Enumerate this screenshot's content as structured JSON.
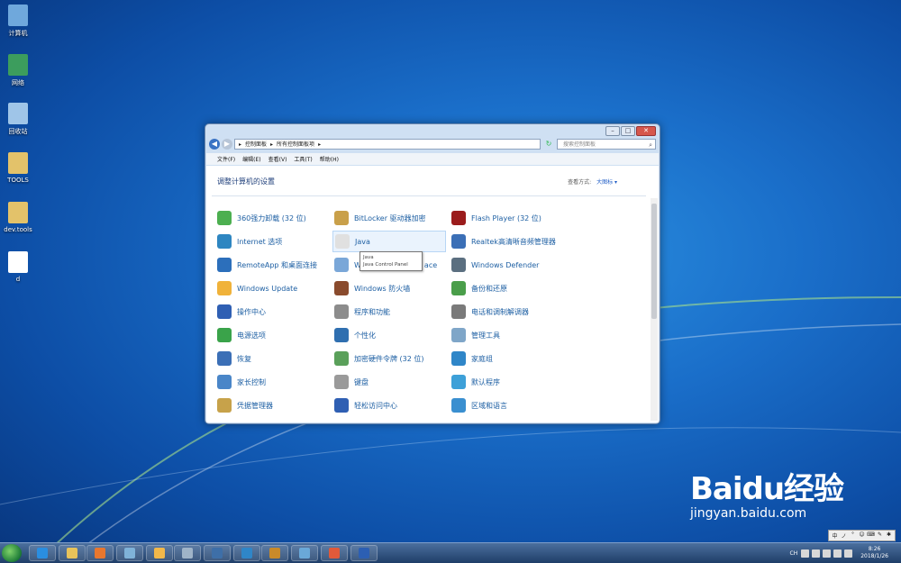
{
  "desktop": {
    "icons": [
      {
        "label": "计算机",
        "color": "#6fa8dc"
      },
      {
        "label": "网络",
        "color": "#3c9d5d"
      },
      {
        "label": "回收站",
        "color": "#9fc5e8"
      },
      {
        "label": "TOOLS",
        "color": "#e3c26a"
      },
      {
        "label": "dev.tools",
        "color": "#e3c26a"
      },
      {
        "label": "d",
        "color": "#ffffff"
      }
    ]
  },
  "window": {
    "breadcrumb": [
      "控制面板",
      "所有控制面板项"
    ],
    "search_placeholder": "搜索控制面板",
    "menu": [
      "文件(F)",
      "编辑(E)",
      "查看(V)",
      "工具(T)",
      "帮助(H)"
    ],
    "heading": "调整计算机的设置",
    "view_by_label": "查看方式:",
    "view_by_value": "大图标 ▾",
    "items": [
      {
        "label": "360强力卸载 (32 位)",
        "color": "#4caf50"
      },
      {
        "label": "BitLocker 驱动器加密",
        "color": "#c9a04a"
      },
      {
        "label": "Flash Player (32 位)",
        "color": "#9b1c1c"
      },
      {
        "label": "Internet 选项",
        "color": "#2e86c1"
      },
      {
        "label": "Java",
        "color": "#e0e0e0"
      },
      {
        "label": "Realtek高清晰音频管理器",
        "color": "#3b6fb6"
      },
      {
        "label": "RemoteApp 和桌面连接",
        "color": "#2c6fbb"
      },
      {
        "label": "W",
        "suffix": "ace",
        "color": "#7aa7d8"
      },
      {
        "label": "Windows Defender",
        "color": "#5b6f80"
      },
      {
        "label": "Windows Update",
        "color": "#f0b23a"
      },
      {
        "label": "Windows 防火墙",
        "color": "#8a4b2d"
      },
      {
        "label": "备份和还原",
        "color": "#4a9e4a"
      },
      {
        "label": "操作中心",
        "color": "#2f5fb3"
      },
      {
        "label": "程序和功能",
        "color": "#8c8c8c"
      },
      {
        "label": "电话和调制解调器",
        "color": "#7a7a7a"
      },
      {
        "label": "电源选项",
        "color": "#3aa34a"
      },
      {
        "label": "个性化",
        "color": "#2f6fb0"
      },
      {
        "label": "管理工具",
        "color": "#7fa6c8"
      },
      {
        "label": "恢复",
        "color": "#3b6fb6"
      },
      {
        "label": "加密硬件令牌 (32 位)",
        "color": "#5aa05a"
      },
      {
        "label": "家庭组",
        "color": "#2f86c8"
      },
      {
        "label": "家长控制",
        "color": "#4a86c8"
      },
      {
        "label": "键盘",
        "color": "#9a9a9a"
      },
      {
        "label": "默认程序",
        "color": "#3da0d8"
      },
      {
        "label": "凭据管理器",
        "color": "#c7a24a"
      },
      {
        "label": "轻松访问中心",
        "color": "#2f5fb3"
      },
      {
        "label": "区域和语言",
        "color": "#3a8fd0"
      }
    ],
    "tooltip": [
      "Java",
      "Java Control Panel"
    ]
  },
  "taskbar": {
    "apps": [
      "#2a8ee0",
      "#e8c35a",
      "#e8772e",
      "#7fb2d8",
      "#f2b84a",
      "#9fb4c8",
      "#3e6fa8",
      "#2f86c8",
      "#c98a2a",
      "#6aa8d8",
      "#e05a3a",
      "#2c5fb3"
    ],
    "time": "8:26",
    "date": "2018/1/26",
    "tray_lang": "CH"
  },
  "ime": [
    "中",
    "ノ",
    "°",
    "☺",
    "⌨",
    "✎",
    "✱"
  ],
  "watermark": {
    "brand": "Baidu经验",
    "url": "jingyan.baidu.com"
  }
}
